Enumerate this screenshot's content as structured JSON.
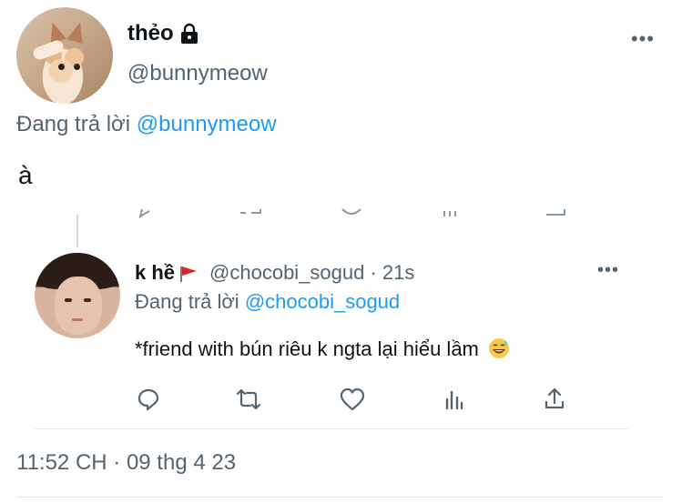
{
  "tweet": {
    "display_name": "thẻo",
    "handle": "@bunnymeow",
    "replying_prefix": "Đang trả lời ",
    "replying_to": "@bunnymeow",
    "text": "à",
    "more": "•••",
    "timestamp": "11:52 CH · 09 thg 4 23",
    "icons": [
      "lock-icon",
      "more-icon"
    ]
  },
  "reply": {
    "display_name": "k hề",
    "handle_and_time": "@chocobi_sogud · 21s",
    "replying_prefix": "Đang trả lời ",
    "replying_to": "@chocobi_sogud",
    "text": "*friend with bún riêu k ngta lại hiểu lầm",
    "more": "•••",
    "icons": [
      "flag-icon",
      "grinning-sweat-emoji-icon",
      "reply-icon",
      "retweet-icon",
      "like-icon",
      "analytics-icon",
      "share-icon"
    ]
  },
  "colors": {
    "text": "#0f1419",
    "secondary": "#536471",
    "accent": "#1d9bf0",
    "flag": "#d62828",
    "divider": "#e1e8ed"
  }
}
